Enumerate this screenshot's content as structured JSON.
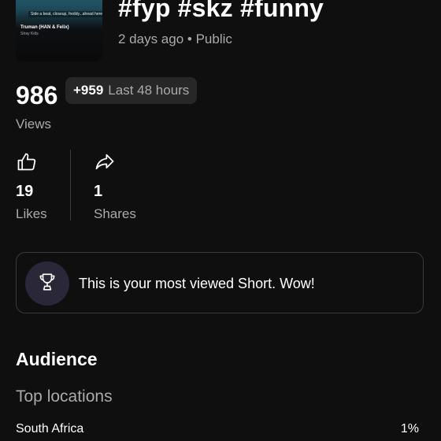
{
  "video": {
    "title": "#fyp #skz #funny",
    "meta": "2 days ago • Public",
    "thumbnail": {
      "caption": "Side a beat, closeup, freddy...ahead here",
      "song": "Truman (HAN & Felix)",
      "artist": "Stray Kids"
    }
  },
  "views": {
    "count": "986",
    "delta": "+959",
    "delta_label": "Last 48 hours",
    "label": "Views"
  },
  "stats": {
    "likes": {
      "count": "19",
      "label": "Likes",
      "icon": "thumbs-up-icon"
    },
    "shares": {
      "count": "1",
      "label": "Shares",
      "icon": "share-arrow-icon"
    }
  },
  "milestone": {
    "text": "This is your most viewed Short. Wow!",
    "icon": "trophy-icon"
  },
  "audience": {
    "title": "Audience",
    "top_locations_label": "Top locations",
    "locations": [
      {
        "name": "South Africa",
        "percent": "1%"
      }
    ]
  },
  "colors": {
    "background": "#0f0f0f",
    "chip_bg": "#272727",
    "secondary_text": "#aaaaaa",
    "trophy_bg": "#2a2738"
  }
}
